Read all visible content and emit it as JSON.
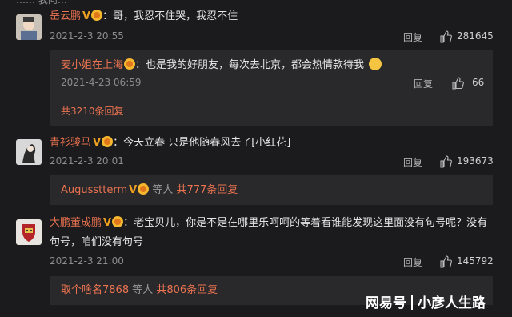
{
  "top_partial": "…… 我问…",
  "comments": [
    {
      "username": "岳云鹏",
      "text": "：哥，我忍不住哭，我忍不住",
      "date": "2021-2-3 20:55",
      "reply_label": "回复",
      "likes": "281645",
      "sub_reply": {
        "username": "麦小姐在上海",
        "text": "：也是我的好朋友，每次去北京，都会热情款待我",
        "date": "2021-4-23 06:59",
        "reply_label": "回复",
        "likes": "66"
      },
      "more_replies": "共3210条回复"
    },
    {
      "username": "青衫骏马",
      "text": "：今天立春 只是他随春风去了[小红花]",
      "date": "2021-2-3 20:01",
      "reply_label": "回复",
      "likes": "193673",
      "more_user": "Augusstterm",
      "more_mid": " 等人 ",
      "more_count": "共777条回复"
    },
    {
      "username": "大鹏董成鹏",
      "text_line1": "：老宝贝儿，你是不是在哪里乐呵呵的等着看谁能发现这里面没有句号呢？没有",
      "text_line2": "句号，咱们没有句号",
      "date": "2021-2-3 21:00",
      "reply_label": "回复",
      "likes": "145792",
      "more_user": "取个啥名7868",
      "more_mid": " 等人 ",
      "more_count": "共806条回复"
    }
  ],
  "watermark": {
    "left": "网易号",
    "right": "小彦人生路"
  },
  "colors": {
    "background": "#1b1b1d",
    "reply_box": "#29292c",
    "username": "#eb7350",
    "badge": "#f0a020"
  }
}
